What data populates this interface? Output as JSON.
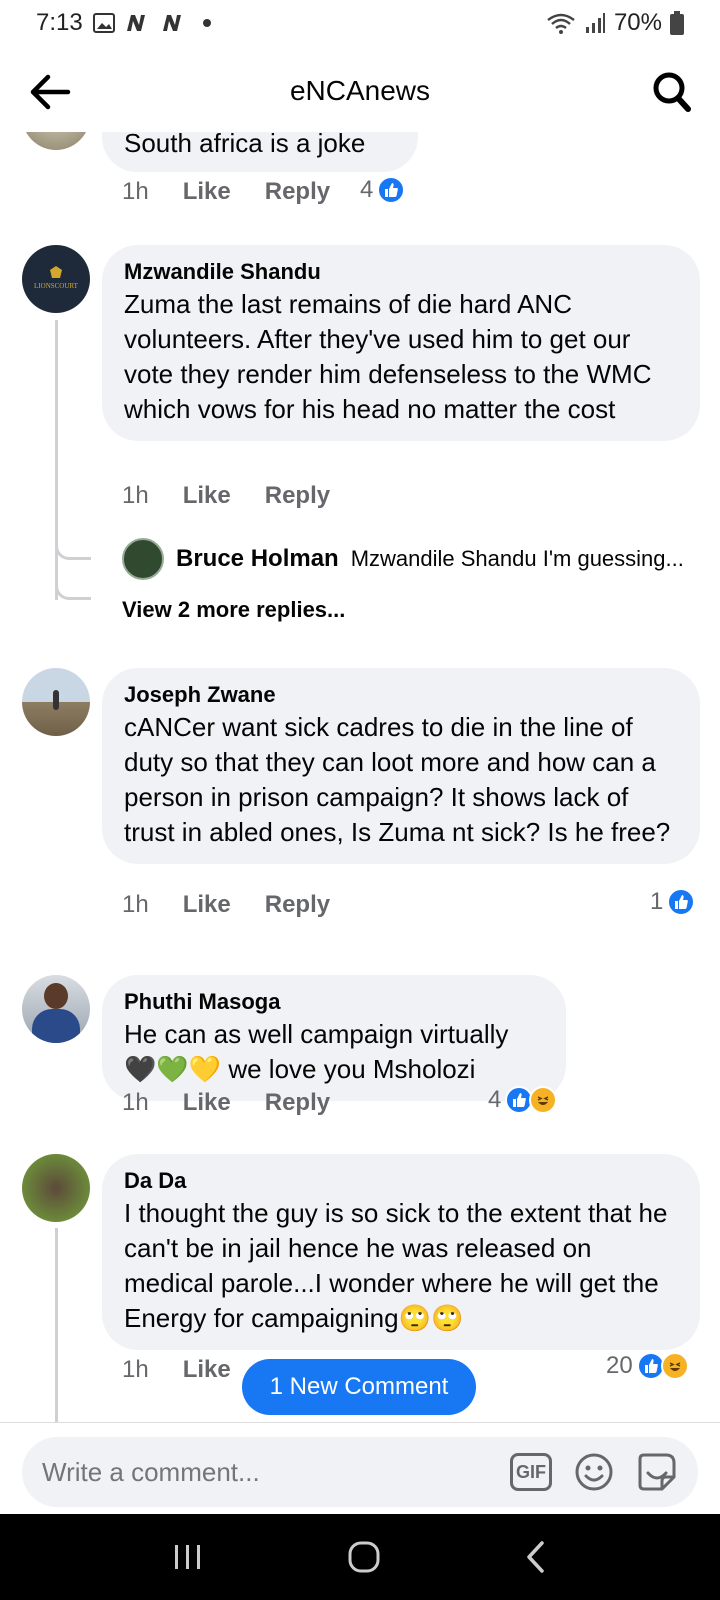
{
  "status": {
    "time": "7:13",
    "battery": "70%"
  },
  "header": {
    "title": "eNCAnews"
  },
  "comments": [
    {
      "author": "",
      "text": "South africa is a joke",
      "time": "1h",
      "like": "Like",
      "reply": "Reply",
      "reaction_count": "4"
    },
    {
      "author": "Mzwandile Shandu",
      "text": "Zuma the last remains of die hard ANC volunteers. After they've used him to get our vote they render him defenseless to the WMC which vows for his head no matter the cost",
      "time": "1h",
      "like": "Like",
      "reply": "Reply",
      "replies": {
        "reply_author": "Bruce Holman",
        "reply_preview": "Mzwandile Shandu I'm guessing...",
        "view_more": "View 2 more replies..."
      }
    },
    {
      "author": "Joseph Zwane",
      "text": "cANCer want sick cadres to die in the line of duty so that they can loot more and how can a person in prison campaign? It shows lack of trust in abled ones, Is Zuma nt sick? Is he free?",
      "time": "1h",
      "like": "Like",
      "reply": "Reply",
      "reaction_count": "1"
    },
    {
      "author": "Phuthi Masoga",
      "text_line1": "He can as well campaign virtually",
      "text_line2_emoji": "🖤💚💛",
      "text_line2": " we love you Msholozi",
      "time": "1h",
      "like": "Like",
      "reply": "Reply",
      "reaction_count": "4"
    },
    {
      "author": "Da Da",
      "text": "I thought the guy is so sick to the extent that he can't be in jail hence he was released on medical parole...I wonder where he will get the Energy for campaigning🙄🙄",
      "time": "1h",
      "like": "Like",
      "reaction_count": "20"
    }
  ],
  "new_comment_button": "1 New Comment",
  "composer": {
    "placeholder": "Write a comment...",
    "gif_label": "GIF"
  },
  "colors": {
    "accent": "#1877f2",
    "bubble": "#f0f2f5",
    "muted": "#65676b"
  }
}
